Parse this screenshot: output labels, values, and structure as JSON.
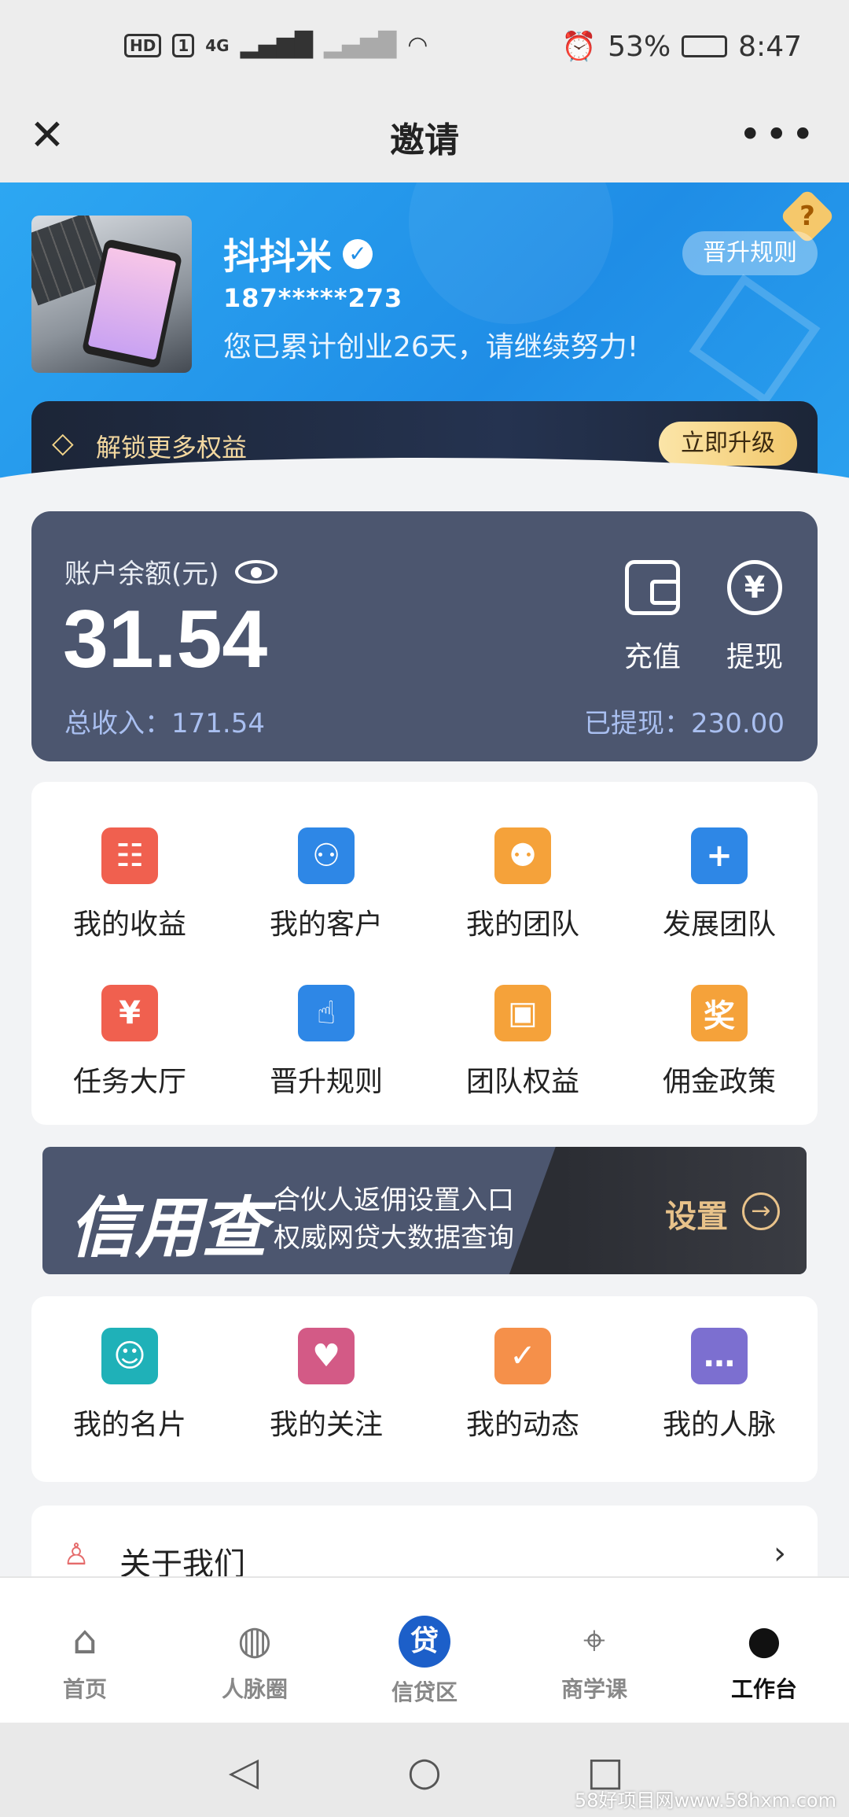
{
  "status_bar": {
    "hd": "HD",
    "sim": "1",
    "net": "4G",
    "battery": "53%",
    "time": "8:47"
  },
  "titlebar": {
    "title": "邀请"
  },
  "profile": {
    "name": "抖抖米",
    "phone": "187*****273",
    "days_text": "您已累计创业26天，请继续努力!",
    "promote_label": "晋升规则",
    "help": "?"
  },
  "unlock": {
    "text": "解锁更多权益",
    "button": "立即升级"
  },
  "account": {
    "label": "账户余额(元)",
    "balance": "31.54",
    "total_income": "总收入：171.54",
    "withdrawn": "已提现：230.00",
    "recharge": "充值",
    "withdraw": "提现"
  },
  "grid1": {
    "items": [
      {
        "label": "我的收益",
        "icon": "calendar-icon",
        "color": "#f0604f"
      },
      {
        "label": "我的客户",
        "icon": "users-icon",
        "color": "#2e87e6"
      },
      {
        "label": "我的团队",
        "icon": "team-icon",
        "color": "#f5a23a"
      },
      {
        "label": "发展团队",
        "icon": "add-team-icon",
        "color": "#2e87e6"
      },
      {
        "label": "任务大厅",
        "icon": "task-icon",
        "color": "#f0604f"
      },
      {
        "label": "晋升规则",
        "icon": "tap-icon",
        "color": "#2e87e6"
      },
      {
        "label": "团队权益",
        "icon": "lock-icon",
        "color": "#f5a23a"
      },
      {
        "label": "佣金政策",
        "icon": "prize-bag-icon",
        "color": "#f5a23a"
      }
    ]
  },
  "credit": {
    "title": "信用查",
    "line1": "合伙人返佣设置入口",
    "line2": "权威网贷大数据查询",
    "action": "设置"
  },
  "grid2": {
    "items": [
      {
        "label": "我的名片",
        "icon": "card-icon",
        "color": "#1fb1b8"
      },
      {
        "label": "我的关注",
        "icon": "heart-icon",
        "color": "#d35a86"
      },
      {
        "label": "我的动态",
        "icon": "edit-icon",
        "color": "#f5904a"
      },
      {
        "label": "我的人脉",
        "icon": "chat-icon",
        "color": "#7c6fd0"
      }
    ]
  },
  "about": {
    "label": "关于我们"
  },
  "tabs": [
    {
      "label": "首页",
      "icon": "home-icon"
    },
    {
      "label": "人脉圈",
      "icon": "planet-icon"
    },
    {
      "label": "信贷区",
      "icon": "loan-icon",
      "glyph": "贷"
    },
    {
      "label": "商学课",
      "icon": "graduation-cap-icon"
    },
    {
      "label": "工作台",
      "icon": "workbench-icon"
    }
  ],
  "watermark": "58好项目网www.58hxm.com"
}
